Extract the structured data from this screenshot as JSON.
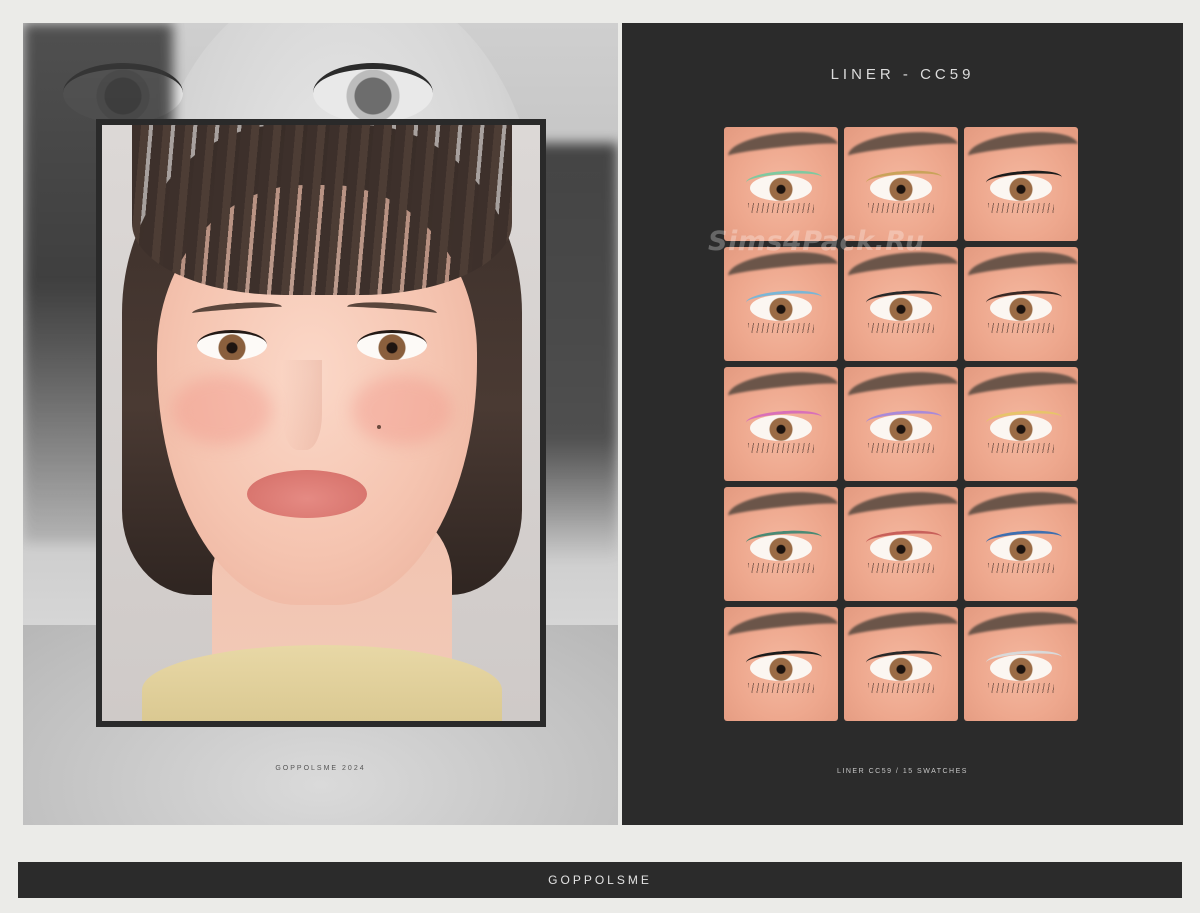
{
  "left_panel": {
    "caption": "GOPPOLSME 2024"
  },
  "right_panel": {
    "title": "LINER - CC59",
    "caption": "LINER CC59 / 15 SWATCHES",
    "watermark": "Sims4Pack.Ru",
    "swatches": [
      {
        "liner_color": "#7fc9a0"
      },
      {
        "liner_color": "#c9a35a"
      },
      {
        "liner_color": "#1c1c1c"
      },
      {
        "liner_color": "#7ab6d6"
      },
      {
        "liner_color": "#2a2a2a"
      },
      {
        "liner_color": "#3a2a26"
      },
      {
        "liner_color": "#d970b8"
      },
      {
        "liner_color": "#a98ad8"
      },
      {
        "liner_color": "#e7c46a"
      },
      {
        "liner_color": "#4a8a74"
      },
      {
        "liner_color": "#c8605a"
      },
      {
        "liner_color": "#3e6fb0"
      },
      {
        "liner_color": "#1c1c1c"
      },
      {
        "liner_color": "#2a2a2a"
      },
      {
        "liner_color": "#d9d9d9"
      }
    ]
  },
  "footer": {
    "label": "GOPPOLSME"
  }
}
